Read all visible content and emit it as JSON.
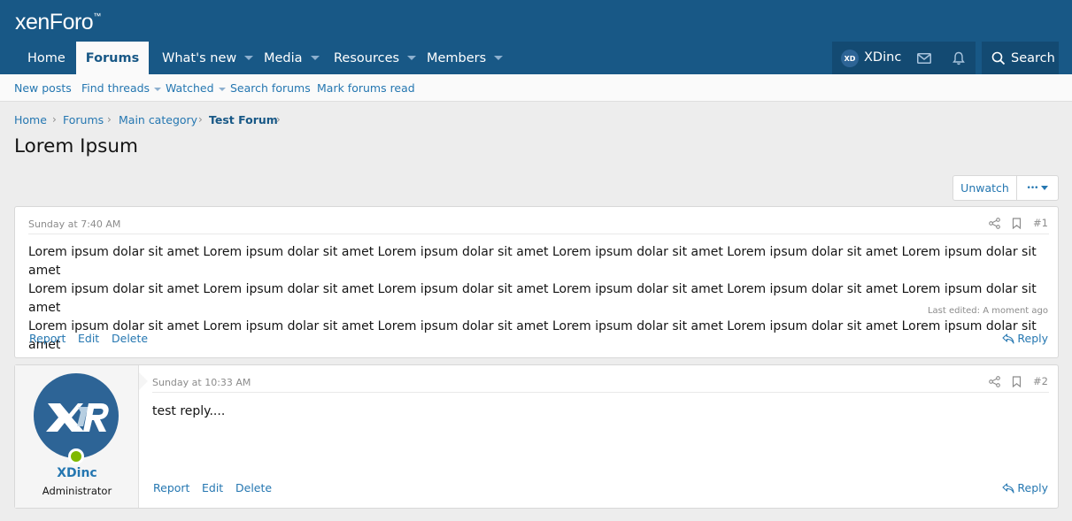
{
  "logo": {
    "text": "xenForo",
    "mark": "™"
  },
  "nav": {
    "tabs": [
      {
        "label": "Home",
        "active": false,
        "dropdown": false
      },
      {
        "label": "Forums",
        "active": true,
        "dropdown": false
      },
      {
        "label": "What's new",
        "active": false,
        "dropdown": true
      },
      {
        "label": "Media",
        "active": false,
        "dropdown": true
      },
      {
        "label": "Resources",
        "active": false,
        "dropdown": true
      },
      {
        "label": "Members",
        "active": false,
        "dropdown": true
      }
    ],
    "user": {
      "name": "XDinc",
      "avatar_text": "XD"
    },
    "search_label": "Search"
  },
  "subnav": {
    "items": [
      {
        "label": "New posts"
      },
      {
        "label": "Find threads"
      },
      {
        "label": "Watched"
      },
      {
        "label": "Search forums"
      },
      {
        "label": "Mark forums read"
      }
    ]
  },
  "breadcrumb": [
    "Home",
    "Forums",
    "Main category",
    "Test Forum"
  ],
  "thread": {
    "title": "Lorem Ipsum",
    "unwatch_label": "Unwatch",
    "more_label": "•••"
  },
  "posts": [
    {
      "date": "Sunday at 7:40 AM",
      "number": "#1",
      "body_lines": [
        "Lorem ipsum dolar sit amet Lorem ipsum dolar sit amet Lorem ipsum dolar sit amet Lorem ipsum dolar sit amet Lorem ipsum dolar sit amet Lorem ipsum dolar sit amet",
        "Lorem ipsum dolar sit amet Lorem ipsum dolar sit amet Lorem ipsum dolar sit amet Lorem ipsum dolar sit amet Lorem ipsum dolar sit amet Lorem ipsum dolar sit amet",
        "Lorem ipsum dolar sit amet Lorem ipsum dolar sit amet Lorem ipsum dolar sit amet Lorem ipsum dolar sit amet Lorem ipsum dolar sit amet Lorem ipsum dolar sit amet"
      ],
      "last_edited": "Last edited: A moment ago",
      "actions": [
        "Report",
        "Edit",
        "Delete"
      ],
      "reply_label": "Reply"
    },
    {
      "date": "Sunday at 10:33 AM",
      "number": "#2",
      "body": "test reply....",
      "actions": [
        "Report",
        "Edit",
        "Delete"
      ],
      "reply_label": "Reply",
      "author": {
        "name": "XDinc",
        "title": "Administrator",
        "avatar_text": "XD"
      }
    }
  ],
  "colors": {
    "header": "#185886",
    "link": "#2577b1",
    "online": "#7fb900"
  }
}
